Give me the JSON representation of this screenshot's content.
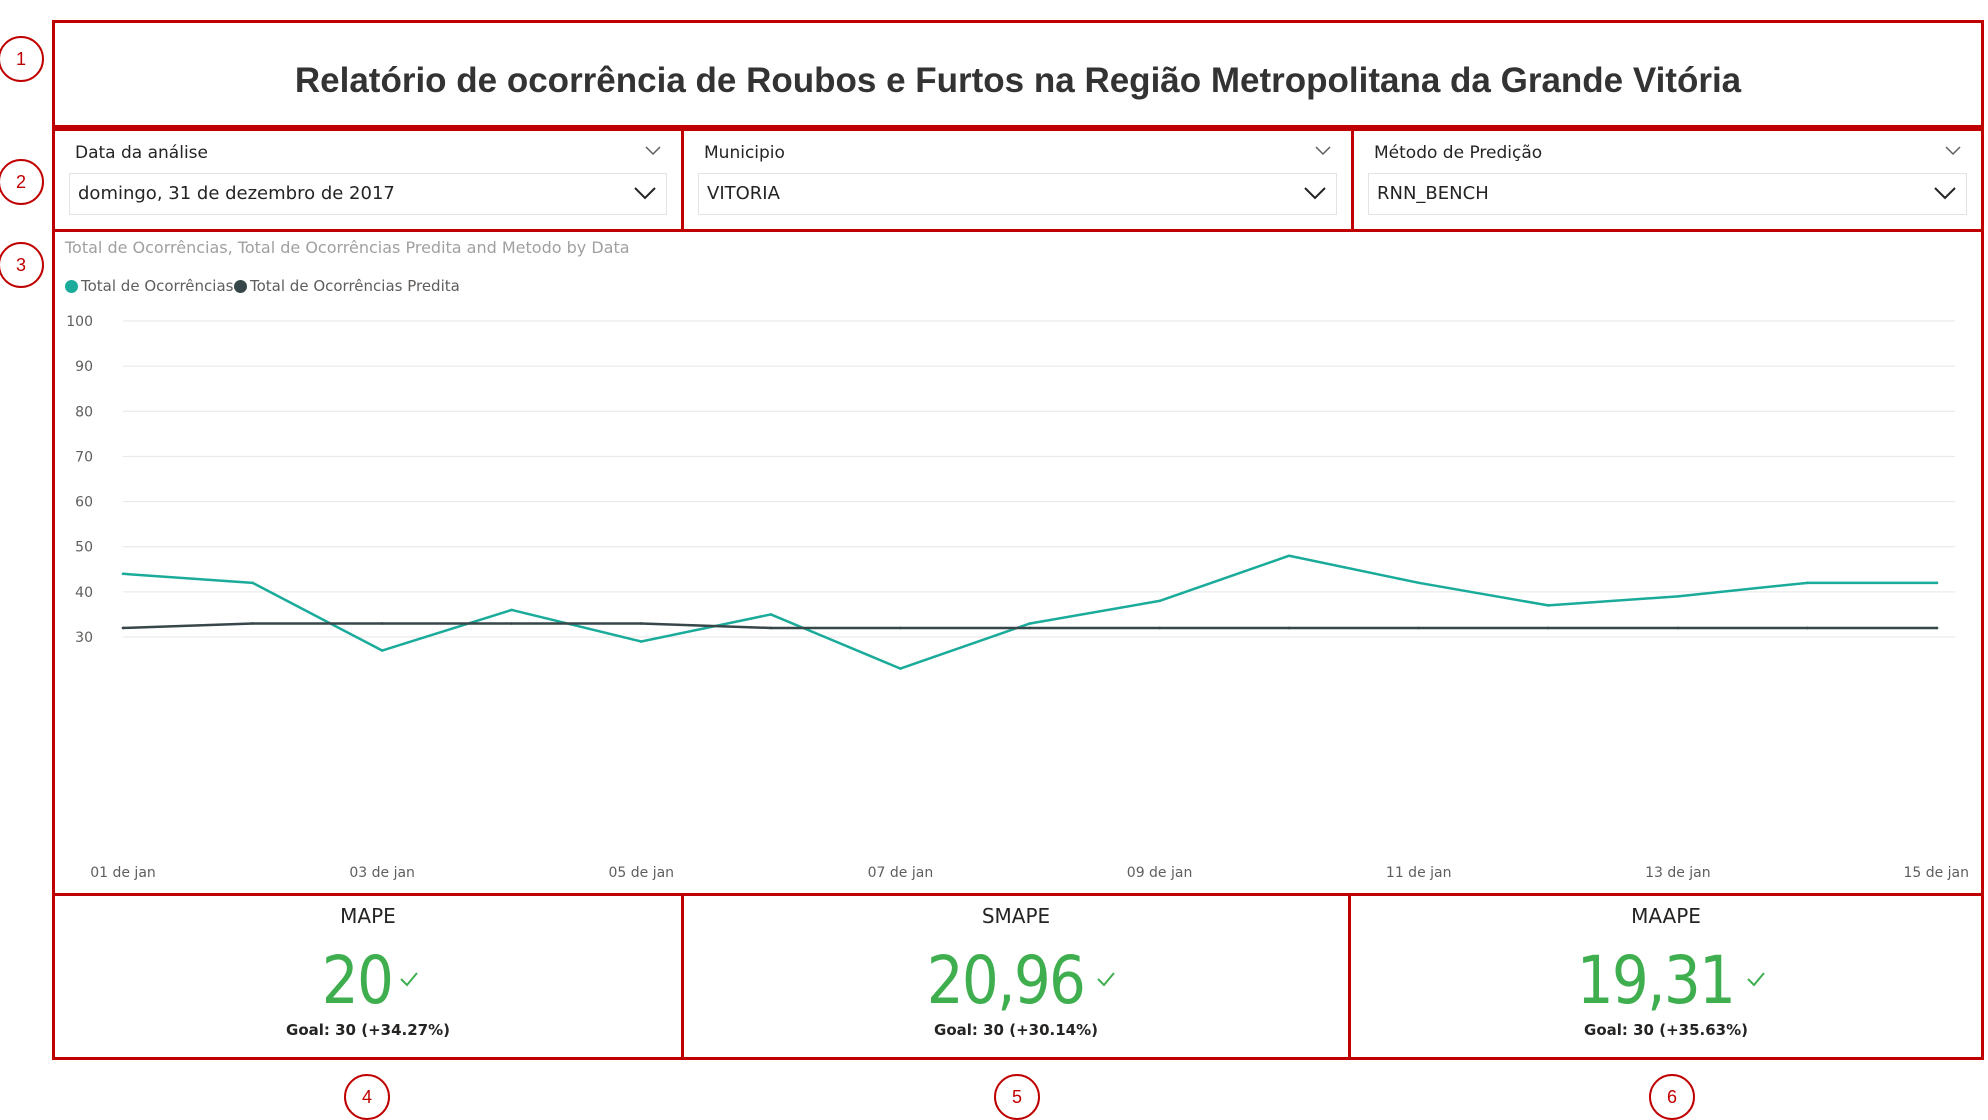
{
  "title": "Relatório de ocorrência de Roubos e Furtos na Região Metropolitana da Grande Vitória",
  "callouts": [
    "1",
    "2",
    "3",
    "4",
    "5",
    "6"
  ],
  "slicers": [
    {
      "label": "Data da análise",
      "value": "domingo, 31 de dezembro de 2017"
    },
    {
      "label": "Municipio",
      "value": "VITORIA"
    },
    {
      "label": "Método de Predição",
      "value": "RNN_BENCH"
    }
  ],
  "chart": {
    "title": "Total de Ocorrências, Total de Ocorrências Predita and Metodo by Data",
    "legend": [
      {
        "name": "Total de Ocorrências",
        "color": "#1aab9b"
      },
      {
        "name": "Total de Ocorrências Predita",
        "color": "#374649"
      }
    ]
  },
  "chart_data": {
    "type": "line",
    "x": [
      "01 de jan",
      "02 de jan",
      "03 de jan",
      "04 de jan",
      "05 de jan",
      "06 de jan",
      "07 de jan",
      "08 de jan",
      "09 de jan",
      "10 de jan",
      "11 de jan",
      "12 de jan",
      "13 de jan",
      "14 de jan",
      "15 de jan"
    ],
    "x_ticks": [
      "01 de jan",
      "03 de jan",
      "05 de jan",
      "07 de jan",
      "09 de jan",
      "11 de jan",
      "13 de jan",
      "15 de jan"
    ],
    "series": [
      {
        "name": "Total de Ocorrências",
        "color": "#1aab9b",
        "values": [
          44,
          42,
          27,
          36,
          29,
          35,
          23,
          33,
          38,
          48,
          42,
          37,
          39,
          42,
          42
        ]
      },
      {
        "name": "Total de Ocorrências Predita",
        "color": "#374649",
        "values": [
          32,
          33,
          33,
          33,
          33,
          32,
          32,
          32,
          32,
          32,
          32,
          32,
          32,
          32,
          32
        ]
      }
    ],
    "y_ticks": [
      30,
      40,
      50,
      60,
      70,
      80,
      90,
      100
    ],
    "ylim": [
      21,
      100
    ],
    "grid": true,
    "legend_position": "top-left"
  },
  "kpis": [
    {
      "name": "MAPE",
      "value": "20",
      "goal": "Goal: 30 (+34.27%)",
      "color": "#3fae4f"
    },
    {
      "name": "SMAPE",
      "value": "20,96",
      "goal": "Goal: 30 (+30.14%)",
      "color": "#3fae4f"
    },
    {
      "name": "MAAPE",
      "value": "19,31",
      "goal": "Goal: 30 (+35.63%)",
      "color": "#3fae4f"
    }
  ]
}
